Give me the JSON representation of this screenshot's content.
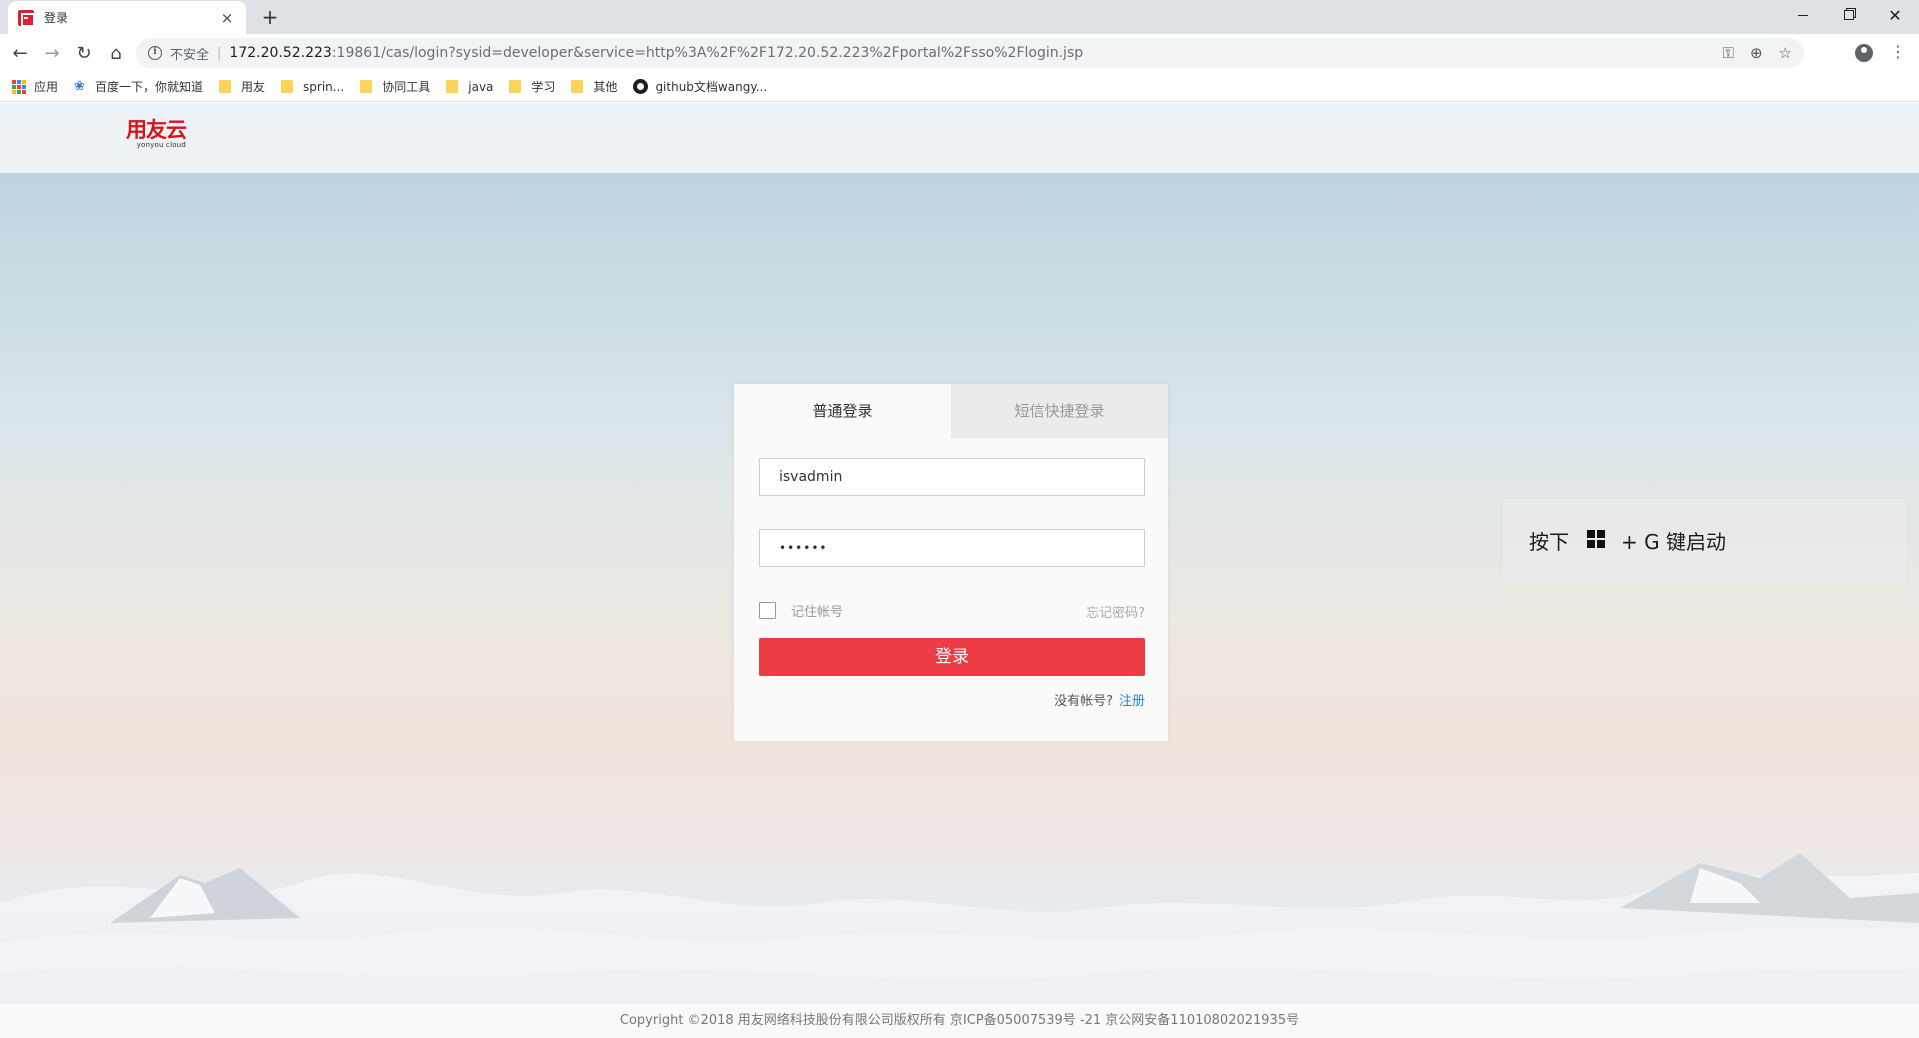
{
  "browser": {
    "tab_title": "登录",
    "tab_close": "×",
    "new_tab": "+",
    "window_controls": {
      "close": "✕"
    },
    "nav": {
      "back": "←",
      "forward": "→",
      "reload": "↻",
      "home": "⌂"
    },
    "address": {
      "security_label": "不安全",
      "separator": "|",
      "host": "172.20.52.223",
      "rest": ":19861/cas/login?sysid=developer&service=http%3A%2F%2F172.20.52.223%2Fportal%2Fsso%2Flogin.jsp"
    },
    "omnibox_icons": {
      "key": "⚿",
      "zoom": "⊕",
      "star": "☆"
    },
    "menu": "⋮",
    "bookmarks": [
      {
        "label": "应用",
        "icon": "apps-icon"
      },
      {
        "label": "百度一下，你就知道",
        "icon": "baidu-paw-icon"
      },
      {
        "label": "用友",
        "icon": "folder-icon"
      },
      {
        "label": "sprin...",
        "icon": "folder-icon"
      },
      {
        "label": "协同工具",
        "icon": "folder-icon"
      },
      {
        "label": "java",
        "icon": "folder-icon"
      },
      {
        "label": "学习",
        "icon": "folder-icon"
      },
      {
        "label": "其他",
        "icon": "folder-icon"
      },
      {
        "label": "github文档wangy...",
        "icon": "github-icon"
      }
    ]
  },
  "page": {
    "logo": {
      "main": "用友云",
      "sub": "yonyou cloud",
      "brand_color": "#d7131b"
    },
    "login": {
      "tab_normal": "普通登录",
      "tab_sms": "短信快捷登录",
      "username_value": "isvadmin",
      "password_value": "••••••",
      "remember_label": "记住帐号",
      "forgot_label": "忘记密码?",
      "login_button": "登录",
      "button_color": "#ee3c47",
      "no_account": "没有帐号?",
      "register_link": "注册"
    },
    "win_tip": {
      "before": "按下",
      "after": "+ G 键启动"
    },
    "footer": "Copyright ©2018 用友网络科技股份有限公司版权所有 京ICP备05007539号 -21 京公网安备11010802021935号"
  }
}
